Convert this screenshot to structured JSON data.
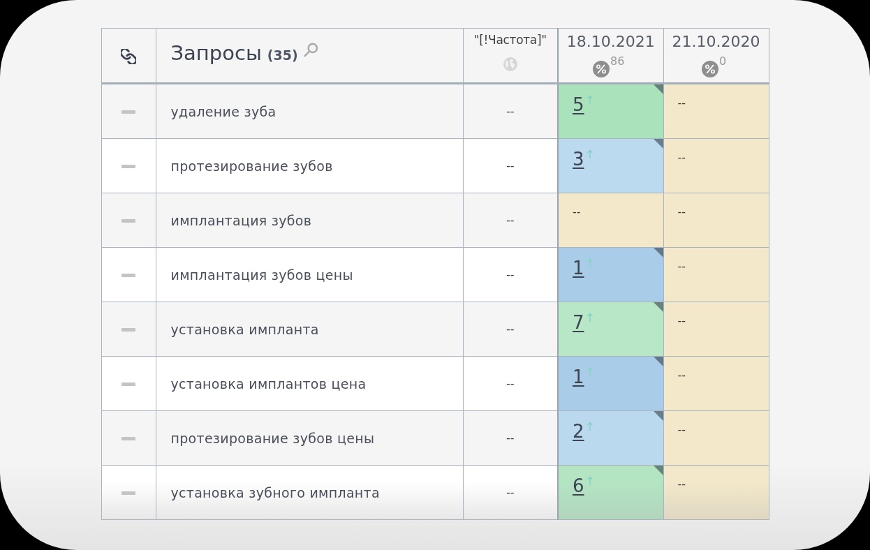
{
  "table": {
    "header": {
      "query": {
        "label": "Запросы",
        "count": "(35)"
      },
      "frequency": {
        "label": "\"[!Частота]\""
      },
      "dates": [
        {
          "label": "18.10.2021",
          "percent": "86"
        },
        {
          "label": "21.10.2020",
          "percent": "0"
        }
      ]
    },
    "rows": [
      {
        "query": "удаление зуба",
        "frequency": "--",
        "positions": [
          {
            "value": "5",
            "kind": "link",
            "color": "#a9e2bb",
            "rising": true,
            "flagged": true
          },
          {
            "value": "--",
            "kind": "plain",
            "color": "#f3e8ca",
            "rising": false,
            "flagged": false
          }
        ]
      },
      {
        "query": "протезирование зубов",
        "frequency": "--",
        "positions": [
          {
            "value": "3",
            "kind": "link",
            "color": "#bbd9ef",
            "rising": true,
            "flagged": true
          },
          {
            "value": "--",
            "kind": "plain",
            "color": "#f3e8ca",
            "rising": false,
            "flagged": false
          }
        ]
      },
      {
        "query": "имплантация зубов",
        "frequency": "--",
        "positions": [
          {
            "value": "--",
            "kind": "plain",
            "color": "#f3e8ca",
            "rising": false,
            "flagged": false
          },
          {
            "value": "--",
            "kind": "plain",
            "color": "#f3e8ca",
            "rising": false,
            "flagged": false
          }
        ]
      },
      {
        "query": "имплантация зубов цены",
        "frequency": "--",
        "positions": [
          {
            "value": "1",
            "kind": "link",
            "color": "#a9cde9",
            "rising": true,
            "flagged": true
          },
          {
            "value": "--",
            "kind": "plain",
            "color": "#f3e8ca",
            "rising": false,
            "flagged": false
          }
        ]
      },
      {
        "query": "установка импланта",
        "frequency": "--",
        "positions": [
          {
            "value": "7",
            "kind": "link",
            "color": "#b7e7c6",
            "rising": true,
            "flagged": true
          },
          {
            "value": "--",
            "kind": "plain",
            "color": "#f3e8ca",
            "rising": false,
            "flagged": false
          }
        ]
      },
      {
        "query": "установка имплантов цена",
        "frequency": "--",
        "positions": [
          {
            "value": "1",
            "kind": "link",
            "color": "#a9cde9",
            "rising": true,
            "flagged": true
          },
          {
            "value": "--",
            "kind": "plain",
            "color": "#f3e8ca",
            "rising": false,
            "flagged": false
          }
        ]
      },
      {
        "query": "протезирование зубов цены",
        "frequency": "--",
        "positions": [
          {
            "value": "2",
            "kind": "link",
            "color": "#bad9ef",
            "rising": true,
            "flagged": true
          },
          {
            "value": "--",
            "kind": "plain",
            "color": "#f3e8ca",
            "rising": false,
            "flagged": false
          }
        ]
      },
      {
        "query": "установка зубного импланта",
        "frequency": "--",
        "positions": [
          {
            "value": "6",
            "kind": "link",
            "color": "#b3e5c3",
            "rising": true,
            "flagged": true
          },
          {
            "value": "--",
            "kind": "plain",
            "color": "#f3e8ca",
            "rising": false,
            "flagged": false
          }
        ]
      }
    ]
  }
}
